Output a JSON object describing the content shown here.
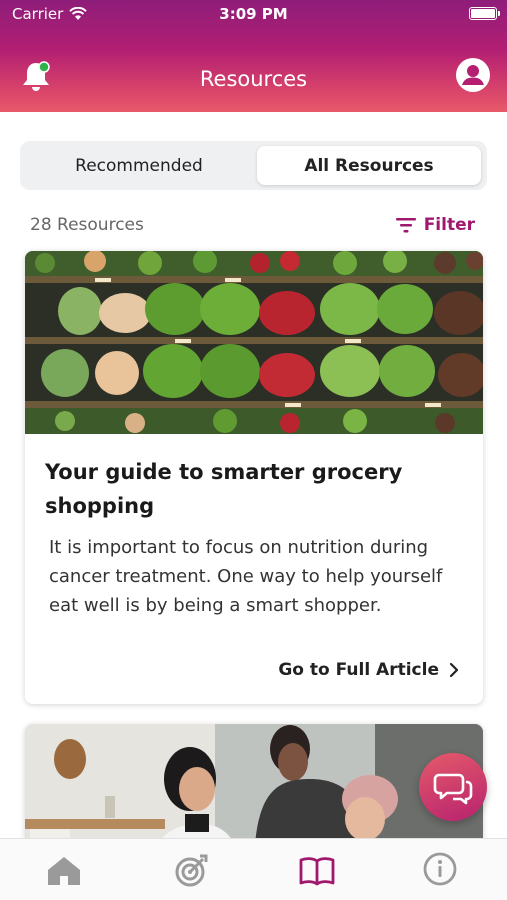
{
  "status_bar": {
    "carrier": "Carrier",
    "time": "3:09 PM"
  },
  "header": {
    "title": "Resources"
  },
  "tabs": [
    {
      "label": "Recommended",
      "selected": false
    },
    {
      "label": "All Resources",
      "selected": true
    }
  ],
  "list": {
    "count_label": "28 Resources",
    "filter_label": "Filter"
  },
  "cards": [
    {
      "title": "Your guide to smarter grocery shopping",
      "description": "It is important to focus on nutrition during cancer treatment. One way to help yourself eat well is by being a smart shopper.",
      "link_label": "Go to Full Article"
    }
  ],
  "tab_bar": {
    "items": [
      {
        "icon": "home-icon",
        "active": false
      },
      {
        "icon": "target-icon",
        "active": false
      },
      {
        "icon": "book-icon",
        "active": true
      },
      {
        "icon": "info-icon",
        "active": false
      }
    ]
  },
  "colors": {
    "accent": "#a0186e",
    "header_top": "#8e1d7a",
    "header_bottom": "#e8596a",
    "notification_dot": "#2db34a",
    "inactive_icon": "#9a9a9a"
  }
}
